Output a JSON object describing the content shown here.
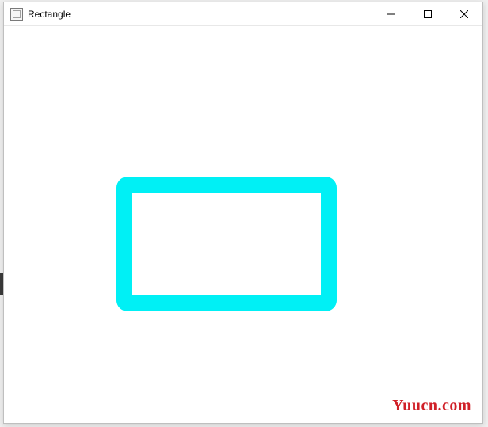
{
  "window": {
    "title": "Rectangle"
  },
  "shape": {
    "border_color": "#00f0f5"
  },
  "watermark": {
    "text": "Yuucn.com",
    "color": "#d02028"
  }
}
